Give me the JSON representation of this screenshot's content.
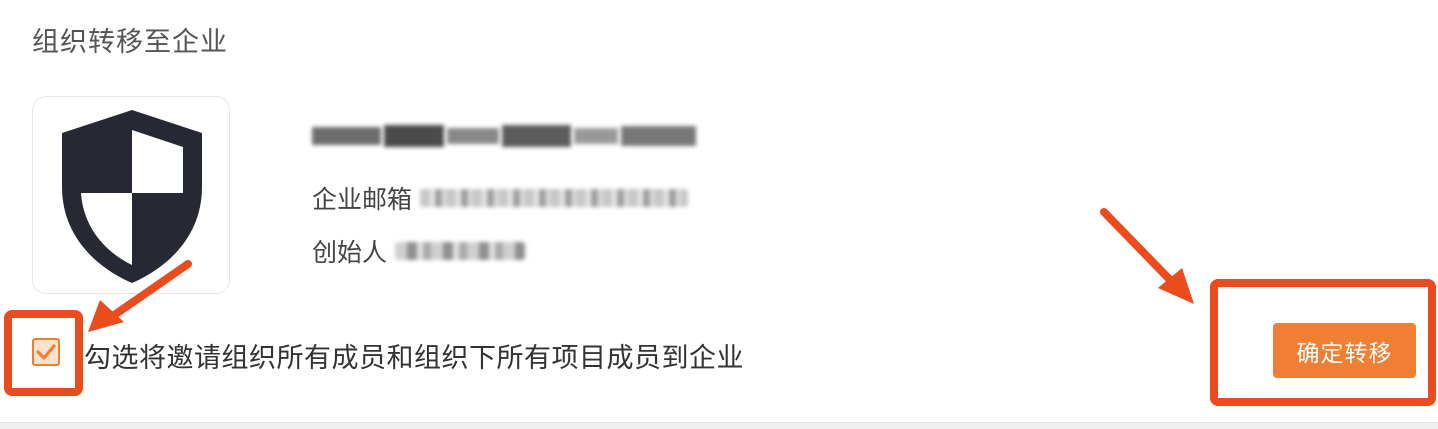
{
  "section": {
    "title": "组织转移至企业"
  },
  "organization": {
    "logo_icon": "shield-icon",
    "email_label": "企业邮箱",
    "founder_label": "创始人"
  },
  "invite_option": {
    "checked": true,
    "label": "勾选将邀请组织所有成员和组织下所有项目成员到企业"
  },
  "actions": {
    "confirm_label": "确定转移"
  },
  "annotations": {
    "highlight_color": "#ea4c1e",
    "icons": [
      "arrow-icon",
      "arrow-icon"
    ]
  },
  "colors": {
    "accent": "#f07e33",
    "checkbox_bg": "#fbe3cf",
    "shield": "#262833"
  }
}
